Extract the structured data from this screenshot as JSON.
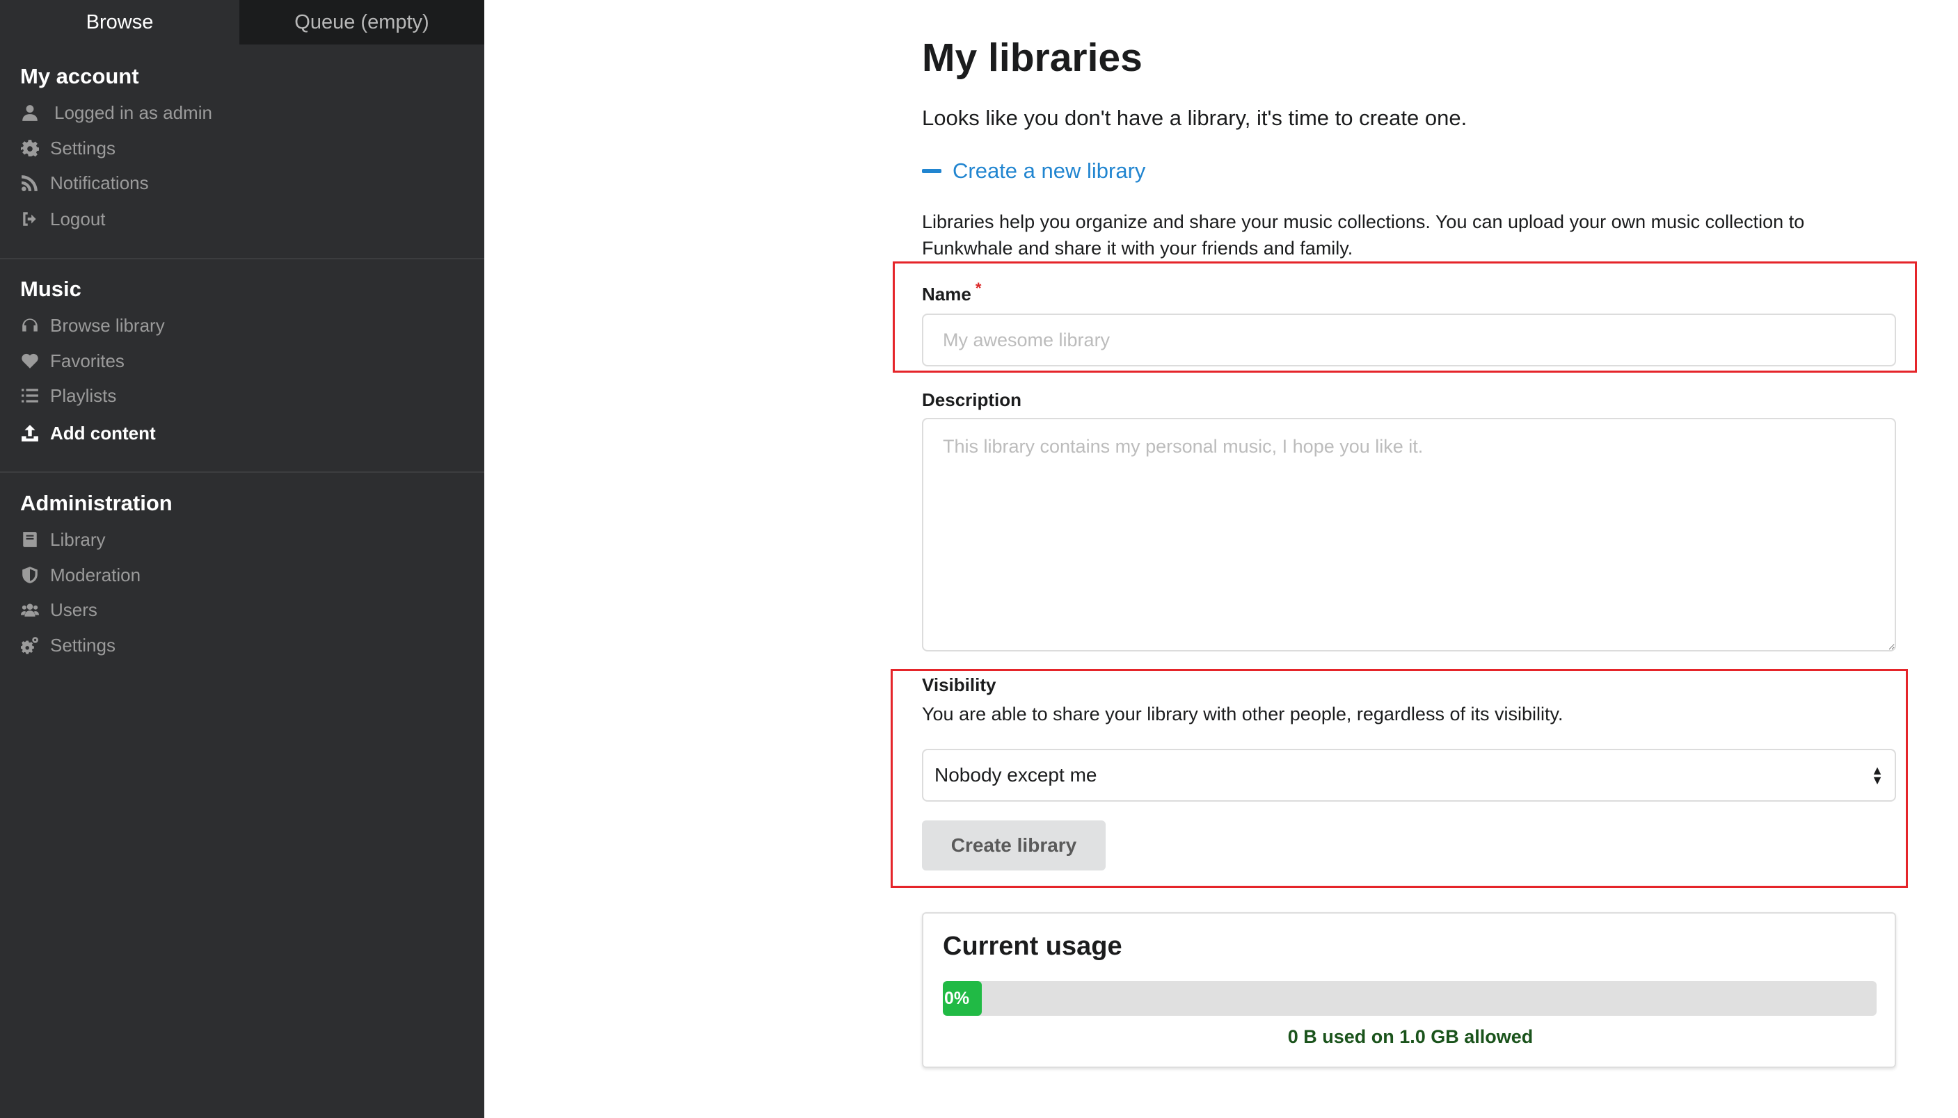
{
  "sidebar": {
    "tabs": [
      {
        "label": "Browse"
      },
      {
        "label": "Queue (empty)"
      }
    ],
    "sections": [
      {
        "title": "My account",
        "items": [
          {
            "label": "Logged in as admin",
            "icon": "user-icon"
          },
          {
            "label": "Settings",
            "icon": "gear-icon"
          },
          {
            "label": "Notifications",
            "icon": "rss-icon"
          },
          {
            "label": "Logout",
            "icon": "sign-out-icon"
          }
        ]
      },
      {
        "title": "Music",
        "items": [
          {
            "label": "Browse library",
            "icon": "headphones-icon"
          },
          {
            "label": "Favorites",
            "icon": "heart-icon"
          },
          {
            "label": "Playlists",
            "icon": "list-icon"
          },
          {
            "label": "Add content",
            "icon": "upload-icon"
          }
        ]
      },
      {
        "title": "Administration",
        "items": [
          {
            "label": "Library",
            "icon": "book-icon"
          },
          {
            "label": "Moderation",
            "icon": "shield-icon"
          },
          {
            "label": "Users",
            "icon": "users-icon"
          },
          {
            "label": "Settings",
            "icon": "gears-icon"
          }
        ]
      }
    ]
  },
  "main": {
    "title": "My libraries",
    "intro": "Looks like you don't have a library, it's time to create one.",
    "create_toggle": "Create a new library",
    "description": "Libraries help you organize and share your music collections. You can upload your own music collection to Funkwhale and share it with your friends and family.",
    "form": {
      "name_label": "Name",
      "required_marker": "*",
      "name_placeholder": "My awesome library",
      "description_label": "Description",
      "description_placeholder": "This library contains my personal music, I hope you like it.",
      "visibility_label": "Visibility",
      "visibility_help": "You are able to share your library with other people, regardless of its visibility.",
      "visibility_value": "Nobody except me",
      "submit_label": "Create library"
    },
    "usage": {
      "title": "Current usage",
      "percent_label": "0%",
      "percent": 0,
      "summary": "0 B used on 1.0 GB allowed"
    }
  },
  "colors": {
    "sidebar_bg": "#2d2e30",
    "link": "#2185d0",
    "progress": "#21ba45",
    "highlight_box": "#e5252a"
  }
}
